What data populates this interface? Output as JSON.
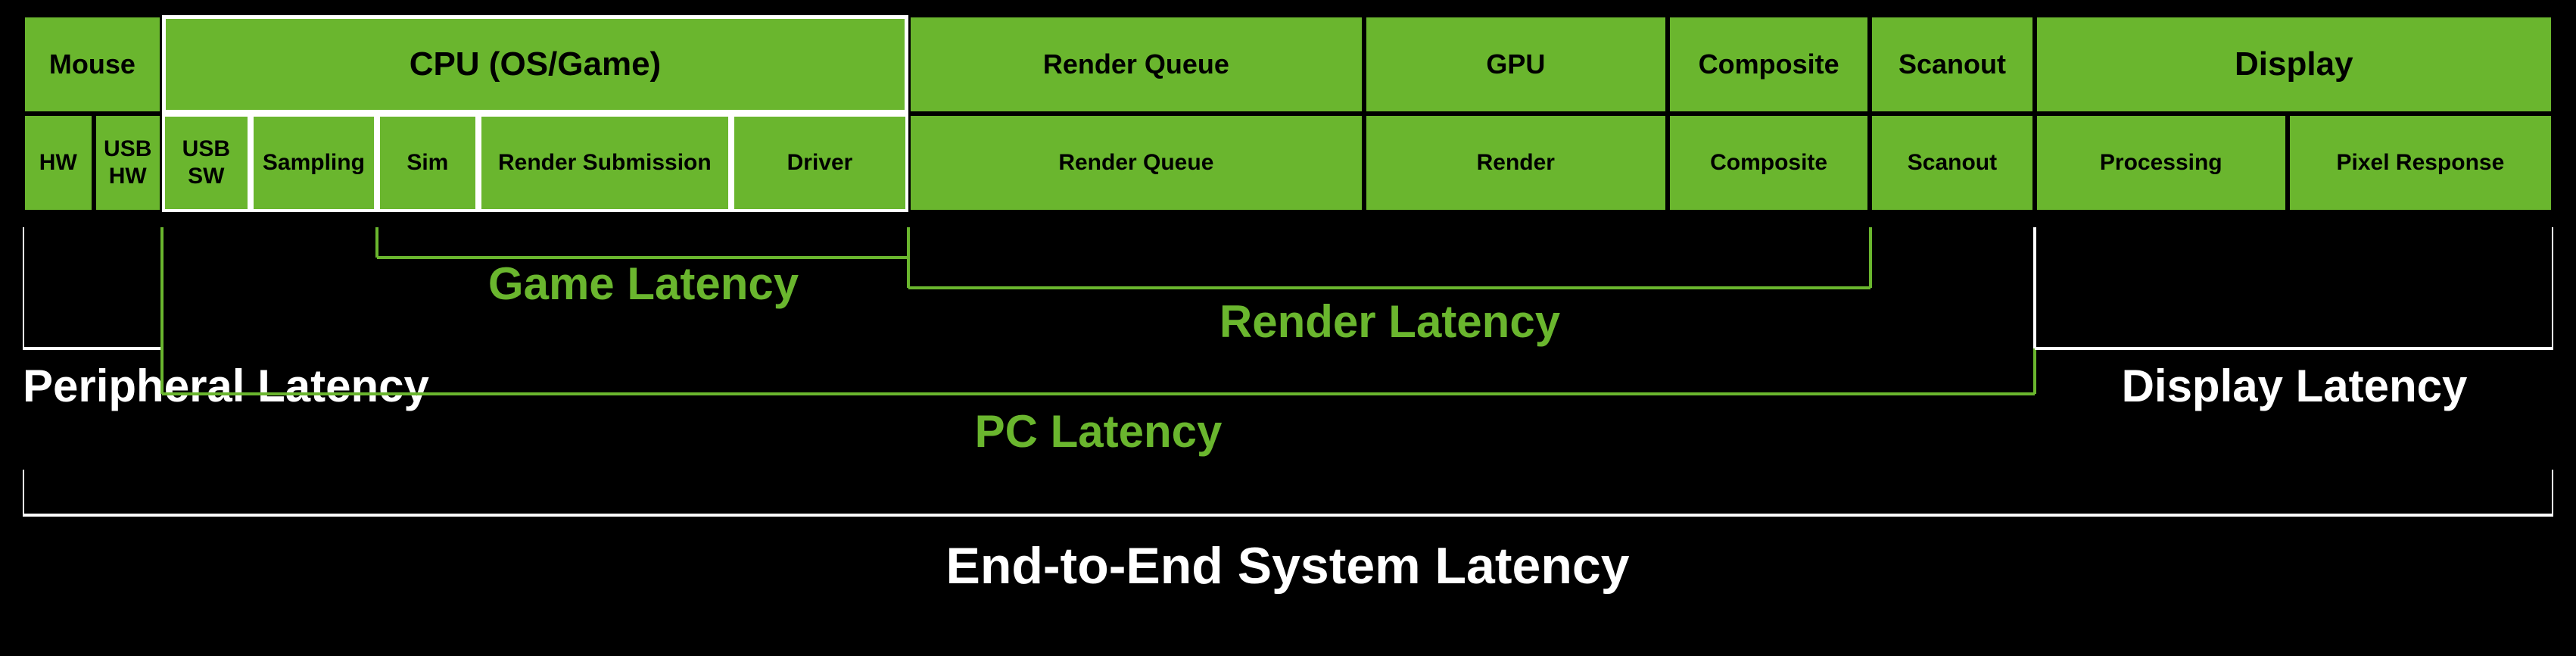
{
  "diagram": {
    "title": "End-to-End System Latency",
    "topBlocks": [
      {
        "id": "mouse",
        "label": "Mouse",
        "widthPct": 5.5
      },
      {
        "id": "cpu",
        "label": "CPU (OS/Game)",
        "widthPct": 29.5,
        "whiteBorder": true
      },
      {
        "id": "render-queue-top",
        "label": "Render Queue",
        "widthPct": 18
      },
      {
        "id": "gpu-top",
        "label": "GPU",
        "widthPct": 12
      },
      {
        "id": "composite-top",
        "label": "Composite",
        "widthPct": 8
      },
      {
        "id": "scanout-top",
        "label": "Scanout",
        "widthPct": 6.5
      },
      {
        "id": "display-top",
        "label": "Display",
        "widthPct": 20.5
      }
    ],
    "subBlocks": [
      {
        "id": "hw",
        "label": "HW",
        "widthPct": 2.8,
        "group": "mouse"
      },
      {
        "id": "usb-hw",
        "label": "USB HW",
        "widthPct": 2.7,
        "group": "mouse"
      },
      {
        "id": "usb-sw",
        "label": "USB SW",
        "widthPct": 3.5,
        "group": "cpu",
        "whiteBorder": true
      },
      {
        "id": "sampling",
        "label": "Sampling",
        "widthPct": 5,
        "group": "cpu",
        "whiteBorder": true
      },
      {
        "id": "sim",
        "label": "Sim",
        "widthPct": 4,
        "group": "cpu",
        "whiteBorder": true
      },
      {
        "id": "render-submission",
        "label": "Render Submission",
        "widthPct": 10,
        "group": "cpu",
        "whiteBorder": true
      },
      {
        "id": "driver",
        "label": "Driver",
        "widthPct": 7,
        "group": "cpu",
        "whiteBorder": true
      },
      {
        "id": "render-queue",
        "label": "Render Queue",
        "widthPct": 18,
        "group": "render-queue"
      },
      {
        "id": "render",
        "label": "Render",
        "widthPct": 12,
        "group": "gpu"
      },
      {
        "id": "composite",
        "label": "Composite",
        "widthPct": 8,
        "group": "composite"
      },
      {
        "id": "scanout",
        "label": "Scanout",
        "widthPct": 6.5,
        "group": "scanout"
      },
      {
        "id": "processing",
        "label": "Processing",
        "widthPct": 10,
        "group": "display"
      },
      {
        "id": "pixel-response",
        "label": "Pixel Response",
        "widthPct": 10.5,
        "group": "display"
      }
    ],
    "latencyLabels": [
      {
        "id": "game-latency",
        "text": "Game Latency",
        "color": "green"
      },
      {
        "id": "render-latency",
        "text": "Render Latency",
        "color": "green"
      },
      {
        "id": "peripheral-latency",
        "text": "Peripheral Latency",
        "color": "white"
      },
      {
        "id": "pc-latency",
        "text": "PC Latency",
        "color": "green"
      },
      {
        "id": "display-latency",
        "text": "Display Latency",
        "color": "white"
      },
      {
        "id": "end-to-end",
        "text": "End-to-End System Latency",
        "color": "white"
      }
    ]
  }
}
